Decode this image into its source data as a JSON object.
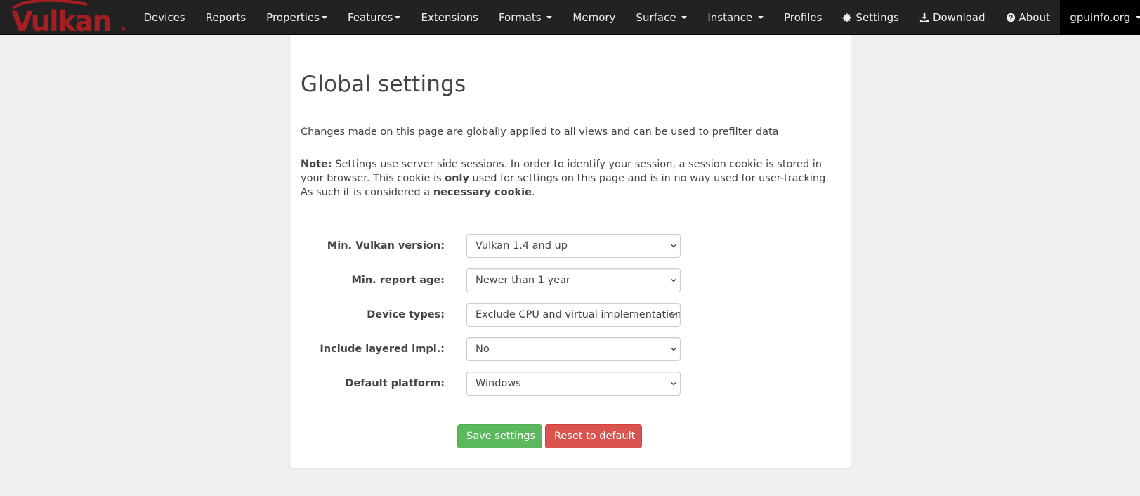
{
  "navbar": {
    "brand": "Vulkan",
    "items": [
      {
        "label": "Devices",
        "dropdown": false
      },
      {
        "label": "Reports",
        "dropdown": false
      },
      {
        "label": "Properties",
        "dropdown": true
      },
      {
        "label": "Features",
        "dropdown": true
      },
      {
        "label": "Extensions",
        "dropdown": false
      },
      {
        "label": "Formats",
        "dropdown": true
      },
      {
        "label": "Memory",
        "dropdown": false
      },
      {
        "label": "Surface",
        "dropdown": true
      },
      {
        "label": "Instance",
        "dropdown": true
      },
      {
        "label": "Profiles",
        "dropdown": false
      },
      {
        "label": "Settings",
        "icon": "gear-icon"
      },
      {
        "label": "Download",
        "icon": "download-icon"
      },
      {
        "label": "About",
        "icon": "question-circle-icon"
      }
    ],
    "site": "gpuinfo.org"
  },
  "page": {
    "title": "Global settings",
    "intro": "Changes made on this page are globally applied to all views and can be used to prefilter data",
    "note": {
      "label": "Note:",
      "text1": " Settings use server side sessions. In order to identify your session, a session cookie is stored in your browser. This cookie is ",
      "bold1": "only",
      "text2": " used for settings on this page and is in no way used for user-tracking. As such it is considered a ",
      "bold2": "necessary cookie",
      "text3": "."
    }
  },
  "form": {
    "fields": [
      {
        "label": "Min. Vulkan version:",
        "value": "Vulkan 1.4 and up"
      },
      {
        "label": "Min. report age:",
        "value": "Newer than 1 year"
      },
      {
        "label": "Device types:",
        "value": "Exclude CPU and virtual implementations"
      },
      {
        "label": "Include layered impl.:",
        "value": "No"
      },
      {
        "label": "Default platform:",
        "value": "Windows"
      }
    ],
    "save_label": "Save settings",
    "reset_label": "Reset to default"
  },
  "colors": {
    "navbar_bg": "#222222",
    "brand_red": "#a41e22",
    "save_green": "#5cb85c",
    "reset_red": "#d9534f",
    "page_bg": "#efefef"
  }
}
